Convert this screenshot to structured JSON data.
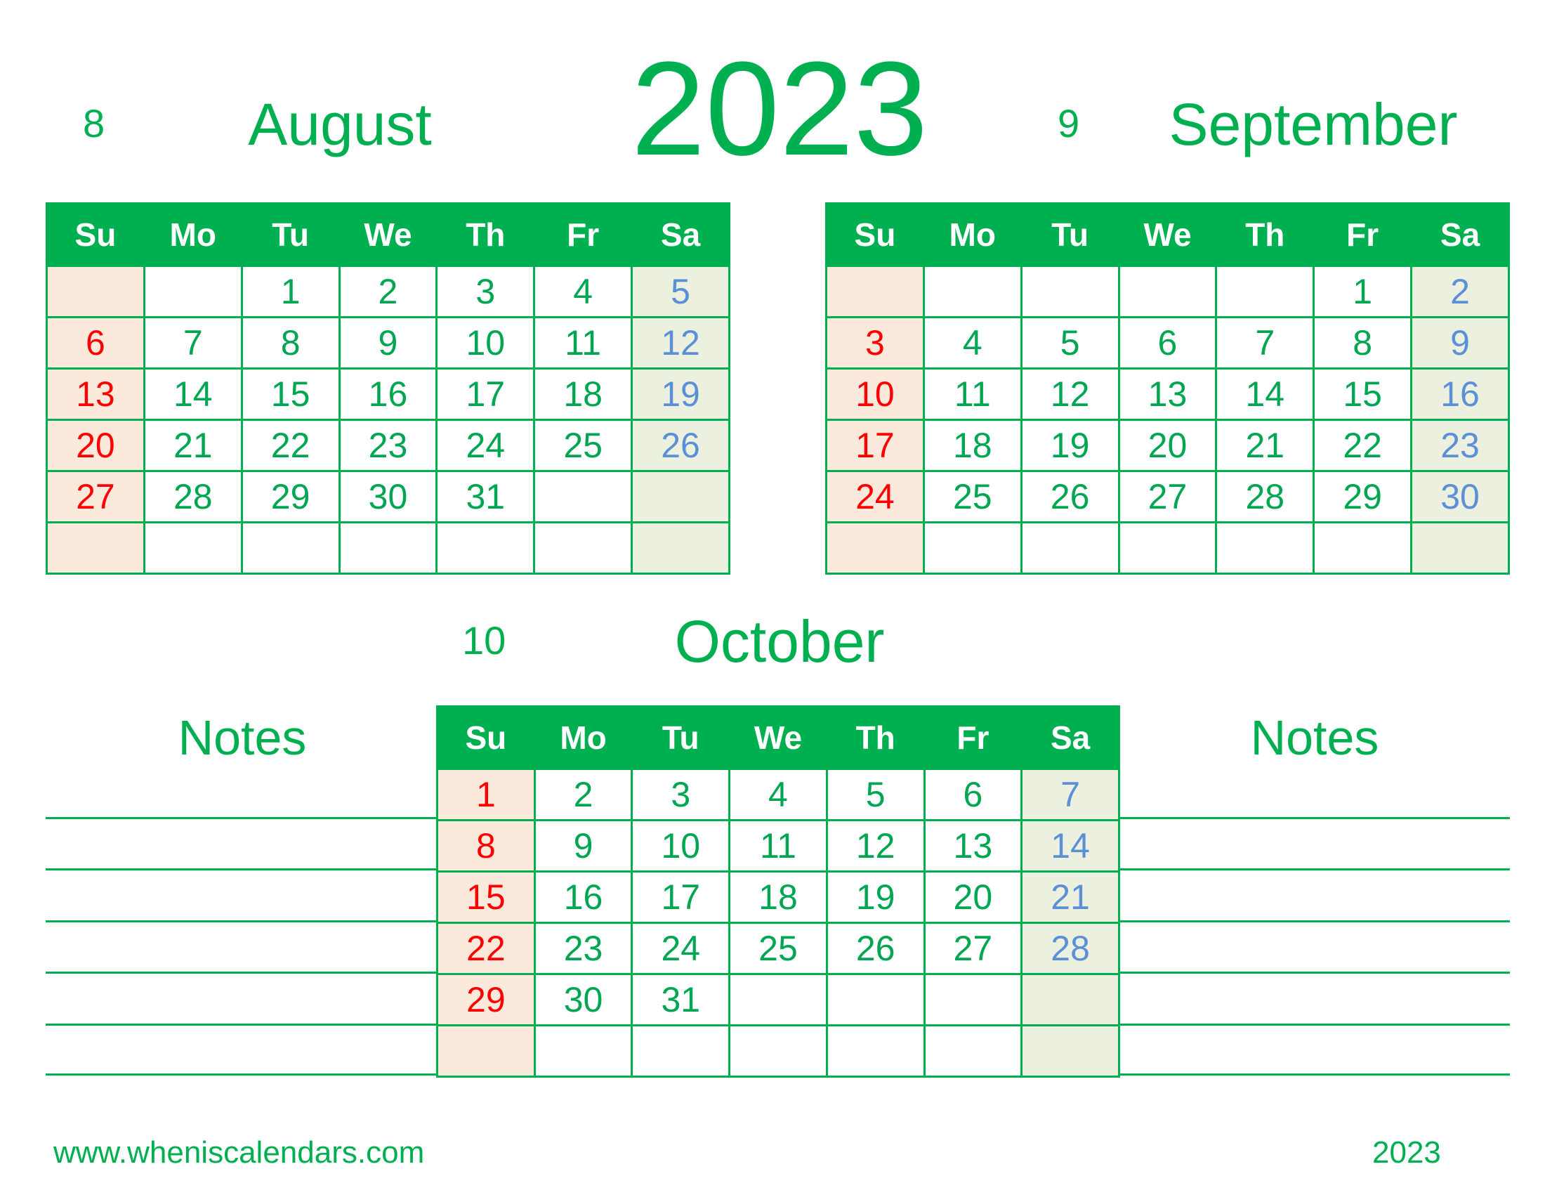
{
  "year": "2023",
  "weekdays": [
    "Su",
    "Mo",
    "Tu",
    "We",
    "Th",
    "Fr",
    "Sa"
  ],
  "months": [
    {
      "number": "8",
      "name": "August",
      "weeks": [
        [
          "",
          "",
          "1",
          "2",
          "3",
          "4",
          "5"
        ],
        [
          "6",
          "7",
          "8",
          "9",
          "10",
          "11",
          "12"
        ],
        [
          "13",
          "14",
          "15",
          "16",
          "17",
          "18",
          "19"
        ],
        [
          "20",
          "21",
          "22",
          "23",
          "24",
          "25",
          "26"
        ],
        [
          "27",
          "28",
          "29",
          "30",
          "31",
          "",
          ""
        ],
        [
          "",
          "",
          "",
          "",
          "",
          "",
          ""
        ]
      ]
    },
    {
      "number": "9",
      "name": "September",
      "weeks": [
        [
          "",
          "",
          "",
          "",
          "",
          "1",
          "2"
        ],
        [
          "3",
          "4",
          "5",
          "6",
          "7",
          "8",
          "9"
        ],
        [
          "10",
          "11",
          "12",
          "13",
          "14",
          "15",
          "16"
        ],
        [
          "17",
          "18",
          "19",
          "20",
          "21",
          "22",
          "23"
        ],
        [
          "24",
          "25",
          "26",
          "27",
          "28",
          "29",
          "30"
        ],
        [
          "",
          "",
          "",
          "",
          "",
          "",
          ""
        ]
      ]
    },
    {
      "number": "10",
      "name": "October",
      "weeks": [
        [
          "1",
          "2",
          "3",
          "4",
          "5",
          "6",
          "7"
        ],
        [
          "8",
          "9",
          "10",
          "11",
          "12",
          "13",
          "14"
        ],
        [
          "15",
          "16",
          "17",
          "18",
          "19",
          "20",
          "21"
        ],
        [
          "22",
          "23",
          "24",
          "25",
          "26",
          "27",
          "28"
        ],
        [
          "29",
          "30",
          "31",
          "",
          "",
          "",
          ""
        ],
        [
          "",
          "",
          "",
          "",
          "",
          "",
          ""
        ]
      ]
    }
  ],
  "notes": {
    "left_title": "Notes",
    "right_title": "Notes"
  },
  "footer": {
    "website": "www.wheniscalendars.com",
    "year": "2023"
  },
  "colors": {
    "accent": "#00b050",
    "sunday_text": "#ff0000",
    "saturday_text": "#5b8fd6",
    "sunday_bg": "#fbeadc",
    "saturday_bg": "#ebf1de"
  }
}
